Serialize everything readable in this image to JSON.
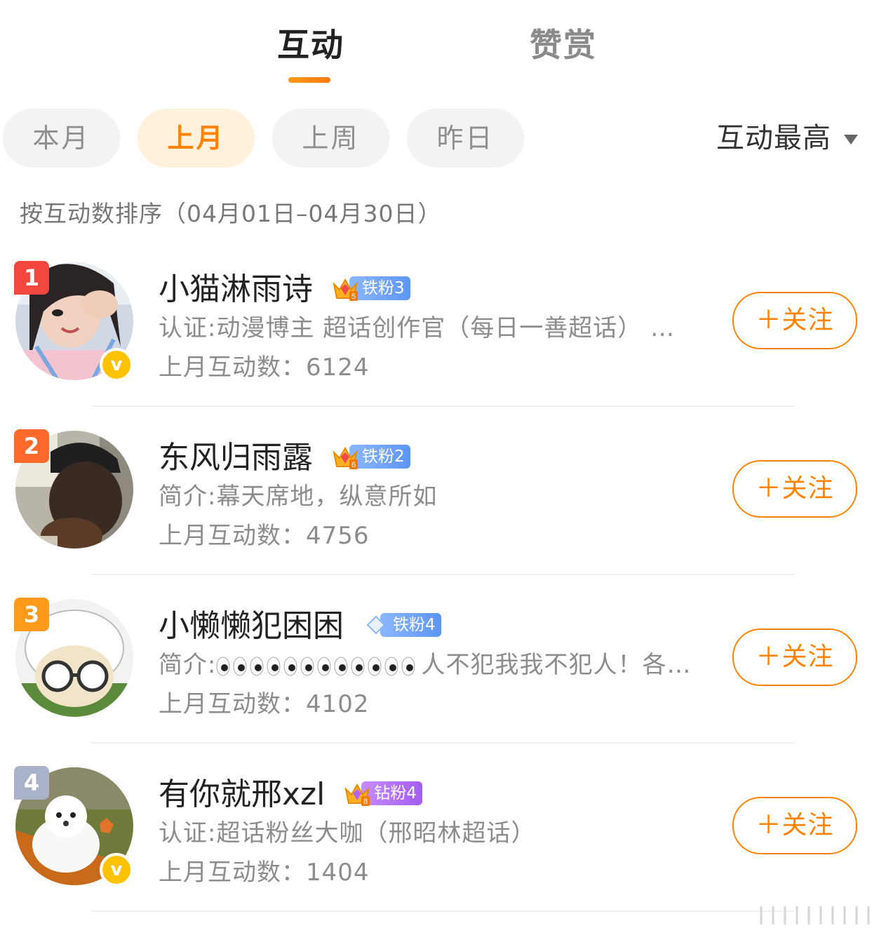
{
  "tabs": [
    {
      "label": "互动",
      "active": true
    },
    {
      "label": "赞赏",
      "active": false
    }
  ],
  "filters": [
    {
      "label": "本月",
      "active": false
    },
    {
      "label": "上月",
      "active": true
    },
    {
      "label": "上周",
      "active": false
    },
    {
      "label": "昨日",
      "active": false
    }
  ],
  "sort_label": "互动最高",
  "range_text": "按互动数排序（04月01日–04月30日）",
  "follow_label": "＋关注",
  "users": [
    {
      "rank": "1",
      "rank_color": "#f2473f",
      "name": "小猫淋雨诗",
      "fan_label": "铁粉3",
      "fan_level": "5",
      "desc": "认证:动漫博主 超话创作官（每日一善超话） …",
      "count": "上月互动数：6124",
      "verified": true
    },
    {
      "rank": "2",
      "rank_color": "#ff6a2a",
      "name": "东风归雨露",
      "fan_label": "铁粉2",
      "fan_level": "6",
      "desc": "简介:幕天席地，纵意所如",
      "count": "上月互动数：4756",
      "verified": false
    },
    {
      "rank": "3",
      "rank_color": "#ff9a1a",
      "name": "小懒懒犯困困",
      "fan_label": "铁粉4",
      "desc_prefix": "简介:",
      "desc_suffix": "人不犯我我不犯人！各…",
      "count": "上月互动数：4102",
      "verified": false
    },
    {
      "rank": "4",
      "rank_color": "#a9b2c8",
      "name": "有你就邢xzl",
      "fan_label": "钻粉4",
      "fan_level": "8",
      "desc": "认证:超话粉丝大咖（邢昭林超话）",
      "count": "上月互动数：1404",
      "verified": true
    }
  ]
}
